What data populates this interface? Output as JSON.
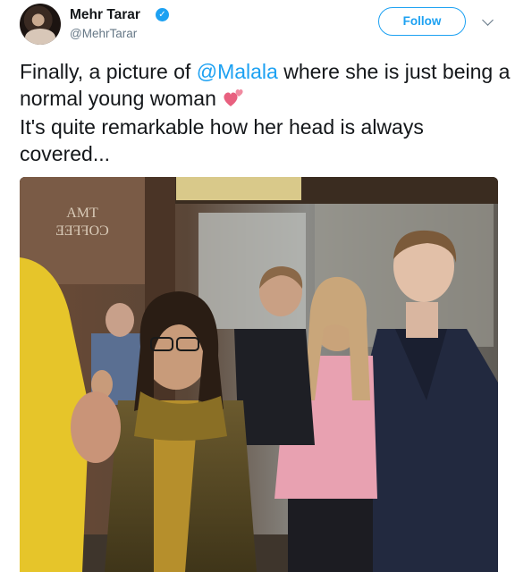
{
  "header": {
    "display_name": "Mehr Tarar",
    "handle": "@MehrTarar",
    "verified_icon": "verified-badge-icon",
    "follow_label": "Follow",
    "menu_icon": "chevron-down-icon"
  },
  "tweet": {
    "text_before_mention": "Finally, a picture of ",
    "mention": "@Malala",
    "text_after_mention": " where she is just being a normal young woman ",
    "emoji": "revolving-hearts-emoji",
    "text_line2": "It's quite remarkable how her head is always covered..."
  },
  "photo": {
    "sign_text_line1": "AMT",
    "sign_text_line2": "COFFEE"
  },
  "colors": {
    "accent": "#1da1f2",
    "text": "#14171a",
    "muted": "#657786"
  }
}
